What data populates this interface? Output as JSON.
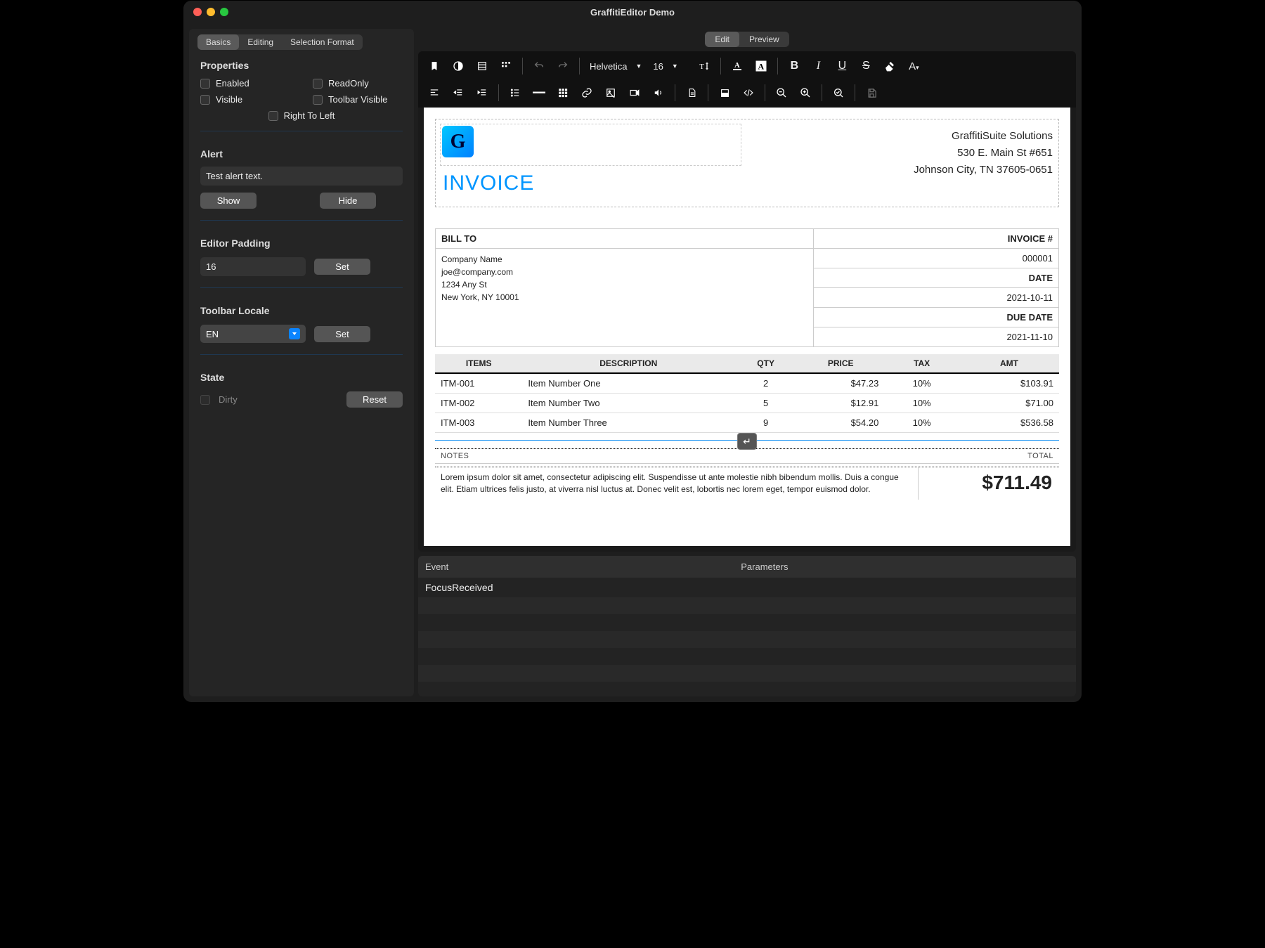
{
  "window": {
    "title": "GraffitiEditor Demo"
  },
  "sidebar": {
    "tabs": [
      "Basics",
      "Editing",
      "Selection Format"
    ],
    "active_tab": 0,
    "properties": {
      "heading": "Properties",
      "enabled_label": "Enabled",
      "readonly_label": "ReadOnly",
      "visible_label": "Visible",
      "toolbar_visible_label": "Toolbar Visible",
      "rtl_label": "Right To Left"
    },
    "alert": {
      "heading": "Alert",
      "text": "Test alert text.",
      "show_label": "Show",
      "hide_label": "Hide"
    },
    "padding": {
      "heading": "Editor Padding",
      "value": "16",
      "set_label": "Set"
    },
    "locale": {
      "heading": "Toolbar Locale",
      "value": "EN",
      "set_label": "Set"
    },
    "state": {
      "heading": "State",
      "dirty_label": "Dirty",
      "reset_label": "Reset"
    }
  },
  "main_tabs": {
    "edit": "Edit",
    "preview": "Preview",
    "active": 0
  },
  "toolbar": {
    "font_family": "Helvetica",
    "font_size": "16"
  },
  "document": {
    "company": {
      "name": "GraffitiSuite Solutions",
      "line1": "530 E. Main St #651",
      "line2": "Johnson City, TN 37605-0651"
    },
    "invoice_title": "INVOICE",
    "labels": {
      "bill_to": "BILL TO",
      "invoice_no": "INVOICE #",
      "date": "DATE",
      "due_date": "DUE DATE",
      "notes": "NOTES",
      "total": "TOTAL",
      "cols": {
        "items": "ITEMS",
        "desc": "DESCRIPTION",
        "qty": "QTY",
        "price": "PRICE",
        "tax": "TAX",
        "amt": "AMT"
      }
    },
    "bill_to": {
      "company": "Company Name",
      "email": "joe@company.com",
      "street": "1234 Any St",
      "city": "New York, NY 10001"
    },
    "invoice_no": "000001",
    "date": "2021-10-11",
    "due_date": "2021-11-10",
    "items": [
      {
        "sku": "ITM-001",
        "desc": "Item Number One",
        "qty": "2",
        "price": "$47.23",
        "tax": "10%",
        "amt": "$103.91"
      },
      {
        "sku": "ITM-002",
        "desc": "Item Number Two",
        "qty": "5",
        "price": "$12.91",
        "tax": "10%",
        "amt": "$71.00"
      },
      {
        "sku": "ITM-003",
        "desc": "Item Number Three",
        "qty": "9",
        "price": "$54.20",
        "tax": "10%",
        "amt": "$536.58"
      }
    ],
    "notes_text": "Lorem ipsum dolor sit amet, consectetur adipiscing elit. Suspendisse ut ante molestie nibh bibendum mollis. Duis a congue elit. Etiam ultrices felis justo, at viverra nisl luctus at. Donec velit est, lobortis nec lorem eget, tempor euismod dolor.",
    "total": "$711.49"
  },
  "events": {
    "col_event": "Event",
    "col_params": "Parameters",
    "rows": [
      {
        "event": "FocusReceived",
        "params": ""
      }
    ]
  }
}
